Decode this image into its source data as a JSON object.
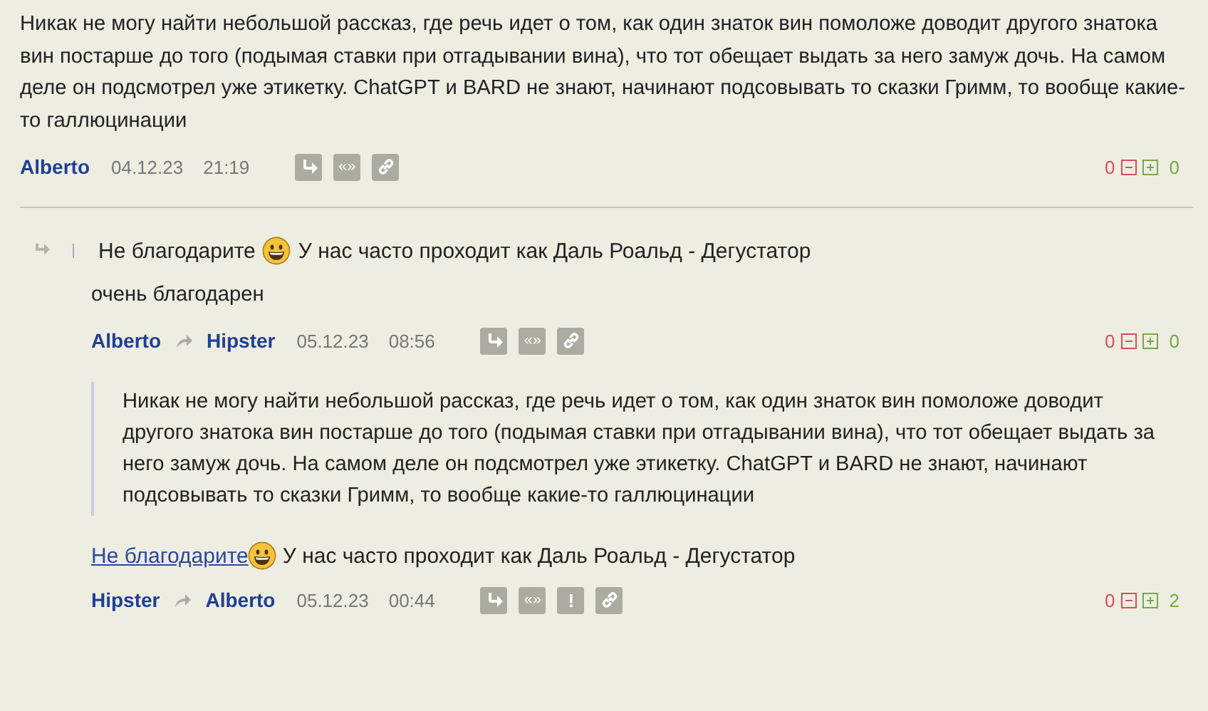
{
  "comments": [
    {
      "body": "Никак не могу найти небольшой рассказ, где речь идет о том, как один знаток вин помоложе доводит другого знатока вин постарше до того (подымая ставки при отгадывании вина), что тот обещает выдать за него замуж дочь. На самом деле он подсмотрел уже этикетку. ChatGPT и BARD не знают, начинают подсовывать то сказки Гримм, то вообще какие-то галлюцинации",
      "author": "Alberto",
      "date": "04.12.23",
      "time": "21:19",
      "actions": [
        {
          "kind": "reply"
        },
        {
          "kind": "quote",
          "label": "«»"
        },
        {
          "kind": "link"
        }
      ],
      "minus": "0",
      "plus": "0",
      "children": [
        {
          "quote_line": {
            "before": "Не благодарите",
            "after": "У нас часто проходит как Даль Роальд - Дегустатор"
          },
          "body": "очень благодарен",
          "author": "Alberto",
          "reply_to": "Hipster",
          "date": "05.12.23",
          "time": "08:56",
          "actions": [
            {
              "kind": "reply"
            },
            {
              "kind": "quote",
              "label": "«»"
            },
            {
              "kind": "link"
            }
          ],
          "minus": "0",
          "plus": "0"
        },
        {
          "blockquote": "Никак не могу найти небольшой рассказ, где речь идет о том, как один знаток вин помоложе доводит другого знатока вин постарше до того (подымая ставки при отгадывании вина), что тот обещает выдать за него замуж дочь. На самом деле он подсмотрел уже этикетку. ChatGPT и BARD не знают, начинают подсовывать то сказки Гримм, то вообще какие-то галлюцинации",
          "link_line": {
            "link": "Не благодарите",
            "after": "У нас часто проходит как Даль Роальд - Дегустатор"
          },
          "author": "Hipster",
          "reply_to": "Alberto",
          "date": "05.12.23",
          "time": "00:44",
          "actions": [
            {
              "kind": "reply"
            },
            {
              "kind": "quote",
              "label": "«»"
            },
            {
              "kind": "report",
              "label": "!"
            },
            {
              "kind": "link"
            }
          ],
          "minus": "0",
          "plus": "2"
        }
      ]
    }
  ]
}
